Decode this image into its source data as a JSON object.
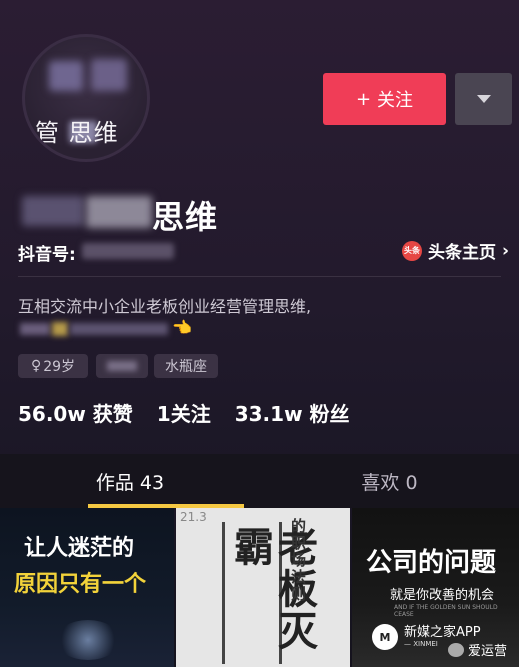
{
  "profile": {
    "avatar_text": "管    思维",
    "name_suffix": "思维",
    "id_label": "抖音号:",
    "headline_link": "头条主页",
    "headline_icon_text": "头条",
    "bio": "互相交流中小企业老板创业经营管理思维,",
    "tags": {
      "age": "29岁",
      "zodiac": "水瓶座"
    },
    "stats": [
      {
        "value": "56.0w",
        "label": "获赞"
      },
      {
        "value": "1",
        "label": "关注"
      },
      {
        "value": "33.1w",
        "label": "粉丝"
      }
    ]
  },
  "actions": {
    "follow_label": "关注",
    "follow_color": "#f03d57"
  },
  "tabs": [
    {
      "label": "作品 43",
      "active": true
    },
    {
      "label": "喜欢 0",
      "active": false
    }
  ],
  "thumbnails": [
    {
      "line1": "让人迷茫的",
      "line2": "原因只有一个"
    },
    {
      "corner": "21.3",
      "big": "老板灭霸",
      "small": "的职场法则"
    },
    {
      "title": "公司的问题",
      "subtitle": "就是你改善的机会",
      "fine": "AND IF THE GOLDEN SUN SHOULD CEASE"
    }
  ],
  "watermark": {
    "brand": "新媒之家APP",
    "brand_sub": "— XINMEI",
    "account": "爱运营",
    "logo_text": "M"
  },
  "colors": {
    "accent": "#f03d57",
    "tab_indicator": "#f5c842"
  }
}
